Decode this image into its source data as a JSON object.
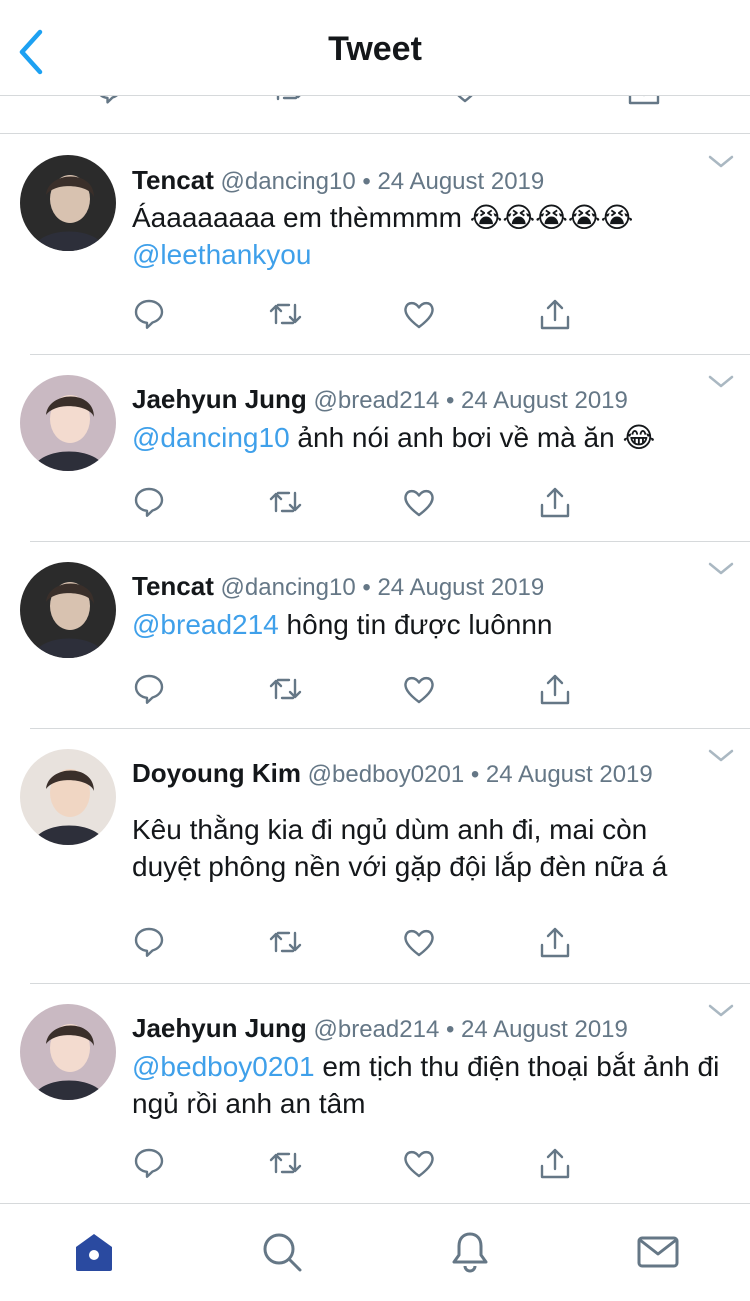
{
  "header": {
    "title": "Tweet",
    "back_icon": "chevron-left-icon"
  },
  "colors": {
    "accent": "#1da1f2",
    "mention": "#3fa0ea",
    "muted": "#657786",
    "home_active": "#2a4aa0"
  },
  "tweets": [
    {
      "name": "Tencat",
      "handle": "@dancing10",
      "dot": "•",
      "date": "24 August 2019",
      "parts": [
        {
          "text": "Áaaaaaaaa em thèmmmm ",
          "mention": false
        },
        {
          "text": "😭😭😭😭😭",
          "mention": false,
          "emoji": true
        },
        {
          "text": "\n",
          "mention": false
        },
        {
          "text": "@leethankyou",
          "mention": true
        }
      ]
    },
    {
      "name": "Jaehyun Jung",
      "handle": "@bread214",
      "dot": "•",
      "date": "24 August 2019",
      "parts": [
        {
          "text": "@dancing10",
          "mention": true
        },
        {
          "text": " ảnh nói anh bơi về mà ăn ",
          "mention": false
        },
        {
          "text": "😂",
          "mention": false,
          "emoji": true
        }
      ]
    },
    {
      "name": "Tencat",
      "handle": "@dancing10",
      "dot": "•",
      "date": "24 August 2019",
      "parts": [
        {
          "text": "@bread214",
          "mention": true
        },
        {
          "text": " hông tin được luônnn",
          "mention": false
        }
      ]
    },
    {
      "name": "Doyoung Kim",
      "handle": "@bedboy0201",
      "dot": "•",
      "date": "24 August 2019",
      "parts": [
        {
          "text": "Kêu thằng kia đi ngủ dùm anh đi, mai còn duyệt phông nền với gặp đội lắp đèn nữa á",
          "mention": false
        }
      ]
    },
    {
      "name": "Jaehyun Jung",
      "handle": "@bread214",
      "dot": "•",
      "date": "24 August 2019",
      "parts": [
        {
          "text": "@bedboy0201",
          "mention": true
        },
        {
          "text": " em tịch thu điện thoại bắt ảnh đi ngủ rồi anh an tâm",
          "mention": false
        }
      ]
    }
  ],
  "tabbar": {
    "items": [
      "home-icon",
      "search-icon",
      "notifications-icon",
      "messages-icon"
    ]
  }
}
